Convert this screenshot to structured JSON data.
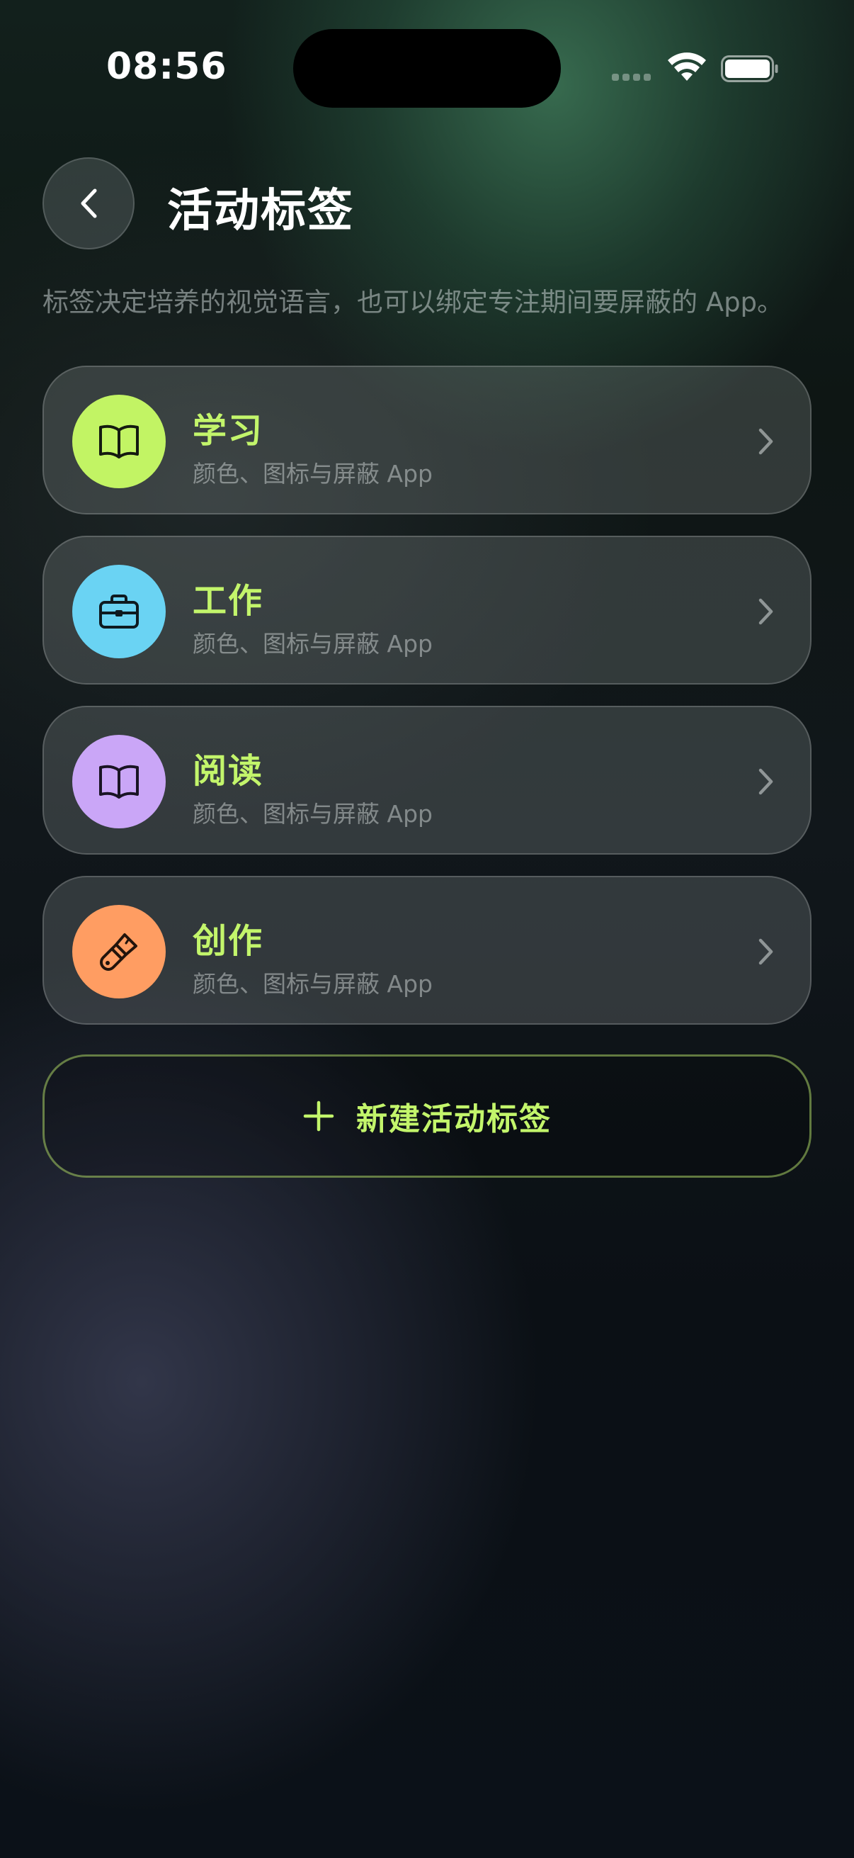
{
  "status_bar": {
    "time": "08:56",
    "signal_icon": "cellular-signal-icon",
    "wifi_icon": "wifi-icon",
    "battery_icon": "battery-icon"
  },
  "header": {
    "back_icon": "chevron-left-icon",
    "title": "活动标签",
    "subtitle": "标签决定培养的视觉语言，也可以绑定专注期间要屏蔽的 App。"
  },
  "tags": [
    {
      "name": "学习",
      "description": "颜色、图标与屏蔽 App",
      "icon": "book-icon",
      "color": "#c2f464"
    },
    {
      "name": "工作",
      "description": "颜色、图标与屏蔽 App",
      "icon": "briefcase-icon",
      "color": "#6ad3f3"
    },
    {
      "name": "阅读",
      "description": "颜色、图标与屏蔽 App",
      "icon": "book-icon",
      "color": "#caa6f7"
    },
    {
      "name": "创作",
      "description": "颜色、图标与屏蔽 App",
      "icon": "paintbrush-icon",
      "color": "#ff9d62"
    }
  ],
  "new_tag_button": {
    "icon": "plus-icon",
    "label": "新建活动标签"
  },
  "colors": {
    "accent": "#c3f56b"
  }
}
